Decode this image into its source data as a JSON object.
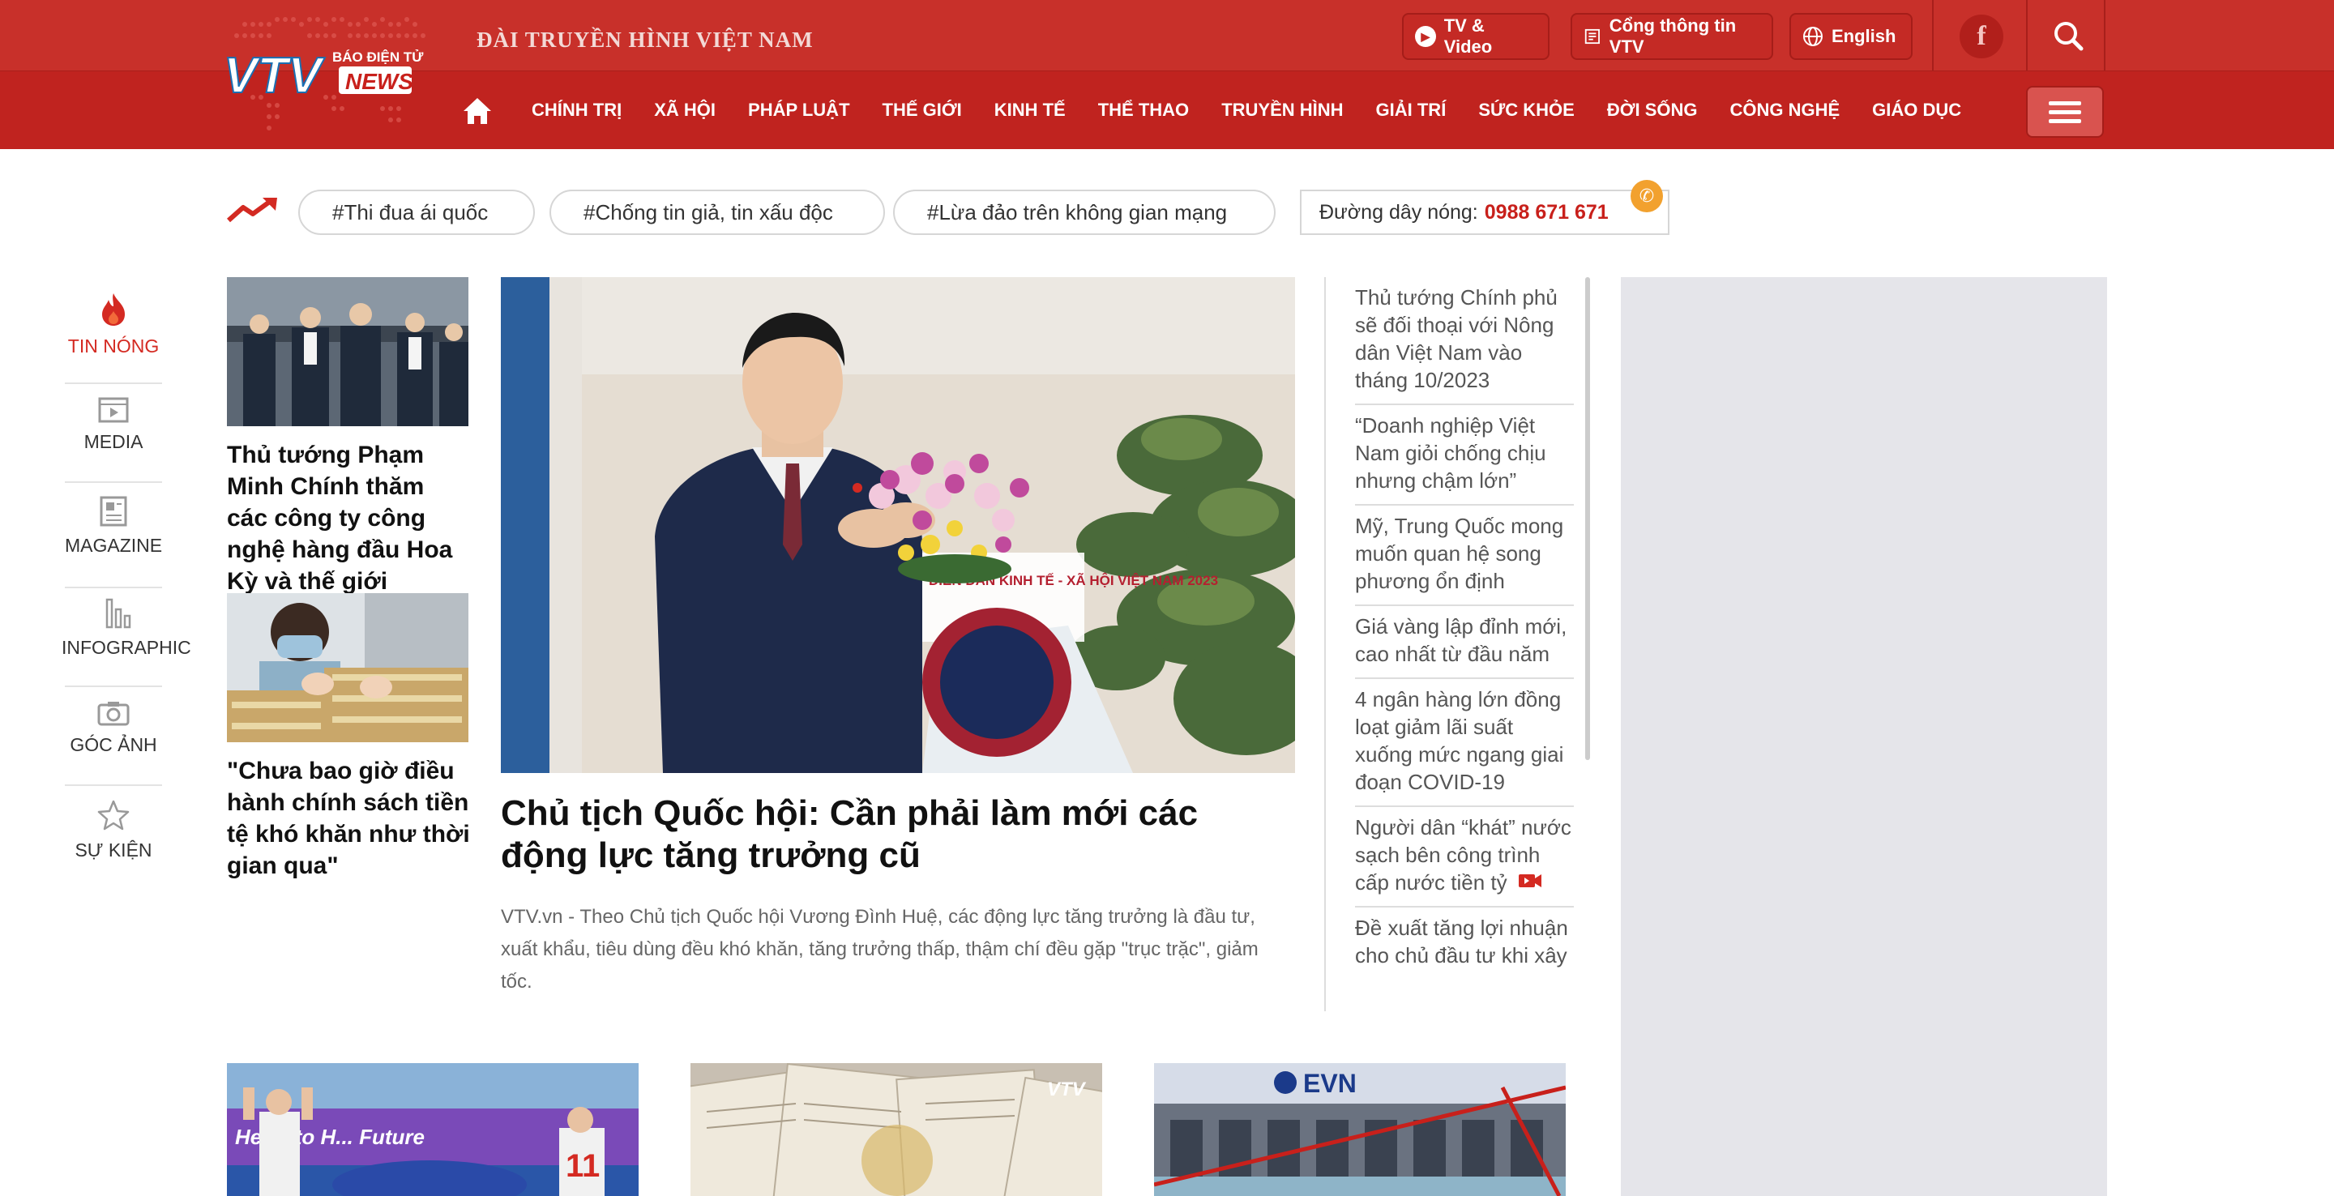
{
  "header": {
    "brand": "ĐÀI TRUYỀN HÌNH VIỆT NAM",
    "logo_text": {
      "top": "BÁO ĐIỆN TỬ",
      "main": "VTV",
      "sub": "NEWS"
    },
    "tv_video": "TV & Video",
    "portal": "Cổng thông tin VTV",
    "english": "English"
  },
  "nav": [
    "CHÍNH TRỊ",
    "XÃ HỘI",
    "PHÁP LUẬT",
    "THẾ GIỚI",
    "KINH TẾ",
    "THỂ THAO",
    "TRUYỀN HÌNH",
    "GIẢI TRÍ",
    "SỨC KHỎE",
    "ĐỜI SỐNG",
    "CÔNG NGHỆ",
    "GIÁO DỤC"
  ],
  "tags": [
    "Thi đua ái quốc",
    "Chống tin giả, tin xấu độc",
    "Lừa đảo trên không gian mạng"
  ],
  "hotline": {
    "label": "Đường dây nóng:",
    "number": "0988 671 671"
  },
  "sidebar": [
    "TIN NÓNG",
    "MEDIA",
    "MAGAZINE",
    "INFOGRAPHIC",
    "GÓC ẢNH",
    "SỰ KIỆN"
  ],
  "left_stories": [
    "Thủ tướng Phạm Minh Chính thăm các công ty công nghệ hàng đầu Hoa Kỳ và thế giới",
    "\"Chưa bao giờ điều hành chính sách tiền tệ khó khăn như thời gian qua\""
  ],
  "main": {
    "title": "Chủ tịch Quốc hội: Cần phải làm mới các động lực tăng trưởng cũ",
    "summary": "VTV.vn - Theo Chủ tịch Quốc hội Vương Đình Huệ, các động lực tăng trưởng là đầu tư, xuất khẩu, tiêu dùng đều khó khăn, tăng trưởng thấp, thậm chí đều gặp \"trục trặc\", giảm tốc.",
    "banner_text": "DIỄN ĐÀN KINH TẾ - XÃ HỘI VIỆT NAM 2023"
  },
  "right_list": [
    "Thủ tướng Chính phủ sẽ đối thoại với Nông dân Việt Nam vào tháng 10/2023",
    "“Doanh nghiệp Việt Nam giỏi chống chịu nhưng chậm lớn”",
    "Mỹ, Trung Quốc mong muốn quan hệ song phương ổn định",
    "Giá vàng lập đỉnh mới, cao nhất từ đầu năm",
    "4 ngân hàng lớn đồng loạt giảm lãi suất xuống mức ngang giai đoạn COVID-19",
    "Người dân “khát” nước sạch bên công trình cấp nước tiền tỷ",
    "Đề xuất tăng lợi nhuận cho chủ đầu tư khi xây"
  ],
  "bottom": {
    "b1_text": "Heart to H... Future",
    "b2_text": "VTV",
    "b3_text": "EVN"
  },
  "colors": {
    "header_red": "#c0231f",
    "accent": "#c8201b",
    "ad_bg": "#e5e5ea"
  }
}
